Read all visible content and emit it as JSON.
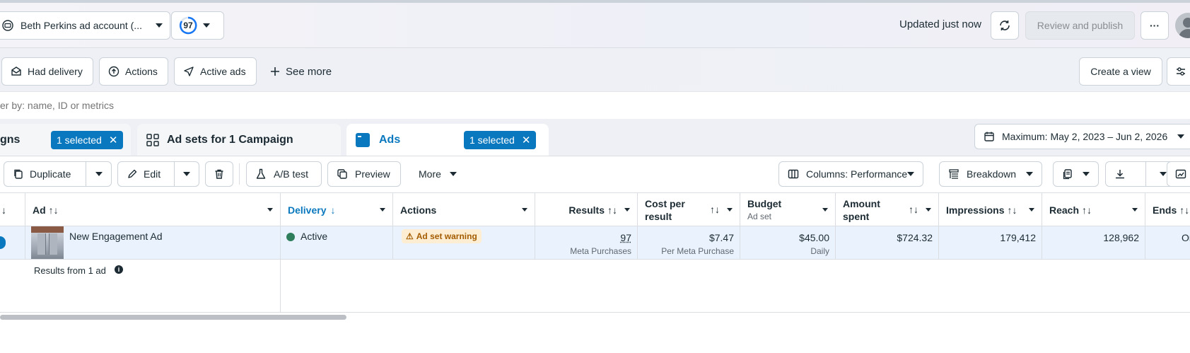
{
  "header": {
    "account_name": "Beth Perkins ad account (...",
    "score": "97",
    "updated": "Updated just now",
    "review_publish": "Review and publish",
    "more": "···"
  },
  "filters": {
    "chips": [
      "Had delivery",
      "Actions",
      "Active ads"
    ],
    "see_more": "See more",
    "create_view": "Create a view"
  },
  "search": {
    "placeholder": "er by: name, ID or metrics"
  },
  "tabs": {
    "campaigns_label": "gns",
    "campaigns_pill": "1 selected",
    "adsets_label": "Ad sets for 1 Campaign",
    "ads_label": "Ads",
    "ads_pill": "1 selected",
    "date_range": "Maximum: May 2, 2023 – Jun 2, 2026"
  },
  "toolbar": {
    "duplicate": "Duplicate",
    "edit": "Edit",
    "ab_test": "A/B test",
    "preview": "Preview",
    "more": "More",
    "columns": "Columns: Performance",
    "breakdown": "Breakdown"
  },
  "columns": {
    "ad": "Ad",
    "delivery": "Delivery",
    "actions": "Actions",
    "results": "Results",
    "cost_per_result_1": "Cost per",
    "cost_per_result_2": "result",
    "budget": "Budget",
    "budget_sub": "Ad set",
    "amount_spent_1": "Amount",
    "amount_spent_2": "spent",
    "impressions": "Impressions",
    "reach": "Reach",
    "ends": "Ends"
  },
  "row": {
    "ad_name": "New Engagement Ad",
    "delivery": "Active",
    "warning": "Ad set warning",
    "results": "97",
    "results_sub": "Meta Purchases",
    "cost": "$7.47",
    "cost_sub": "Per Meta Purchase",
    "budget": "$45.00",
    "budget_sub": "Daily",
    "amount_spent": "$724.32",
    "impressions": "179,412",
    "reach": "128,962",
    "ends": "Or"
  },
  "summary": {
    "label": "Results from 1 ad"
  },
  "colors": {
    "accent": "#0a78be",
    "active_dot": "#2e7d5b",
    "warning_bg": "#fdeed3",
    "warning_text": "#a45c00"
  }
}
